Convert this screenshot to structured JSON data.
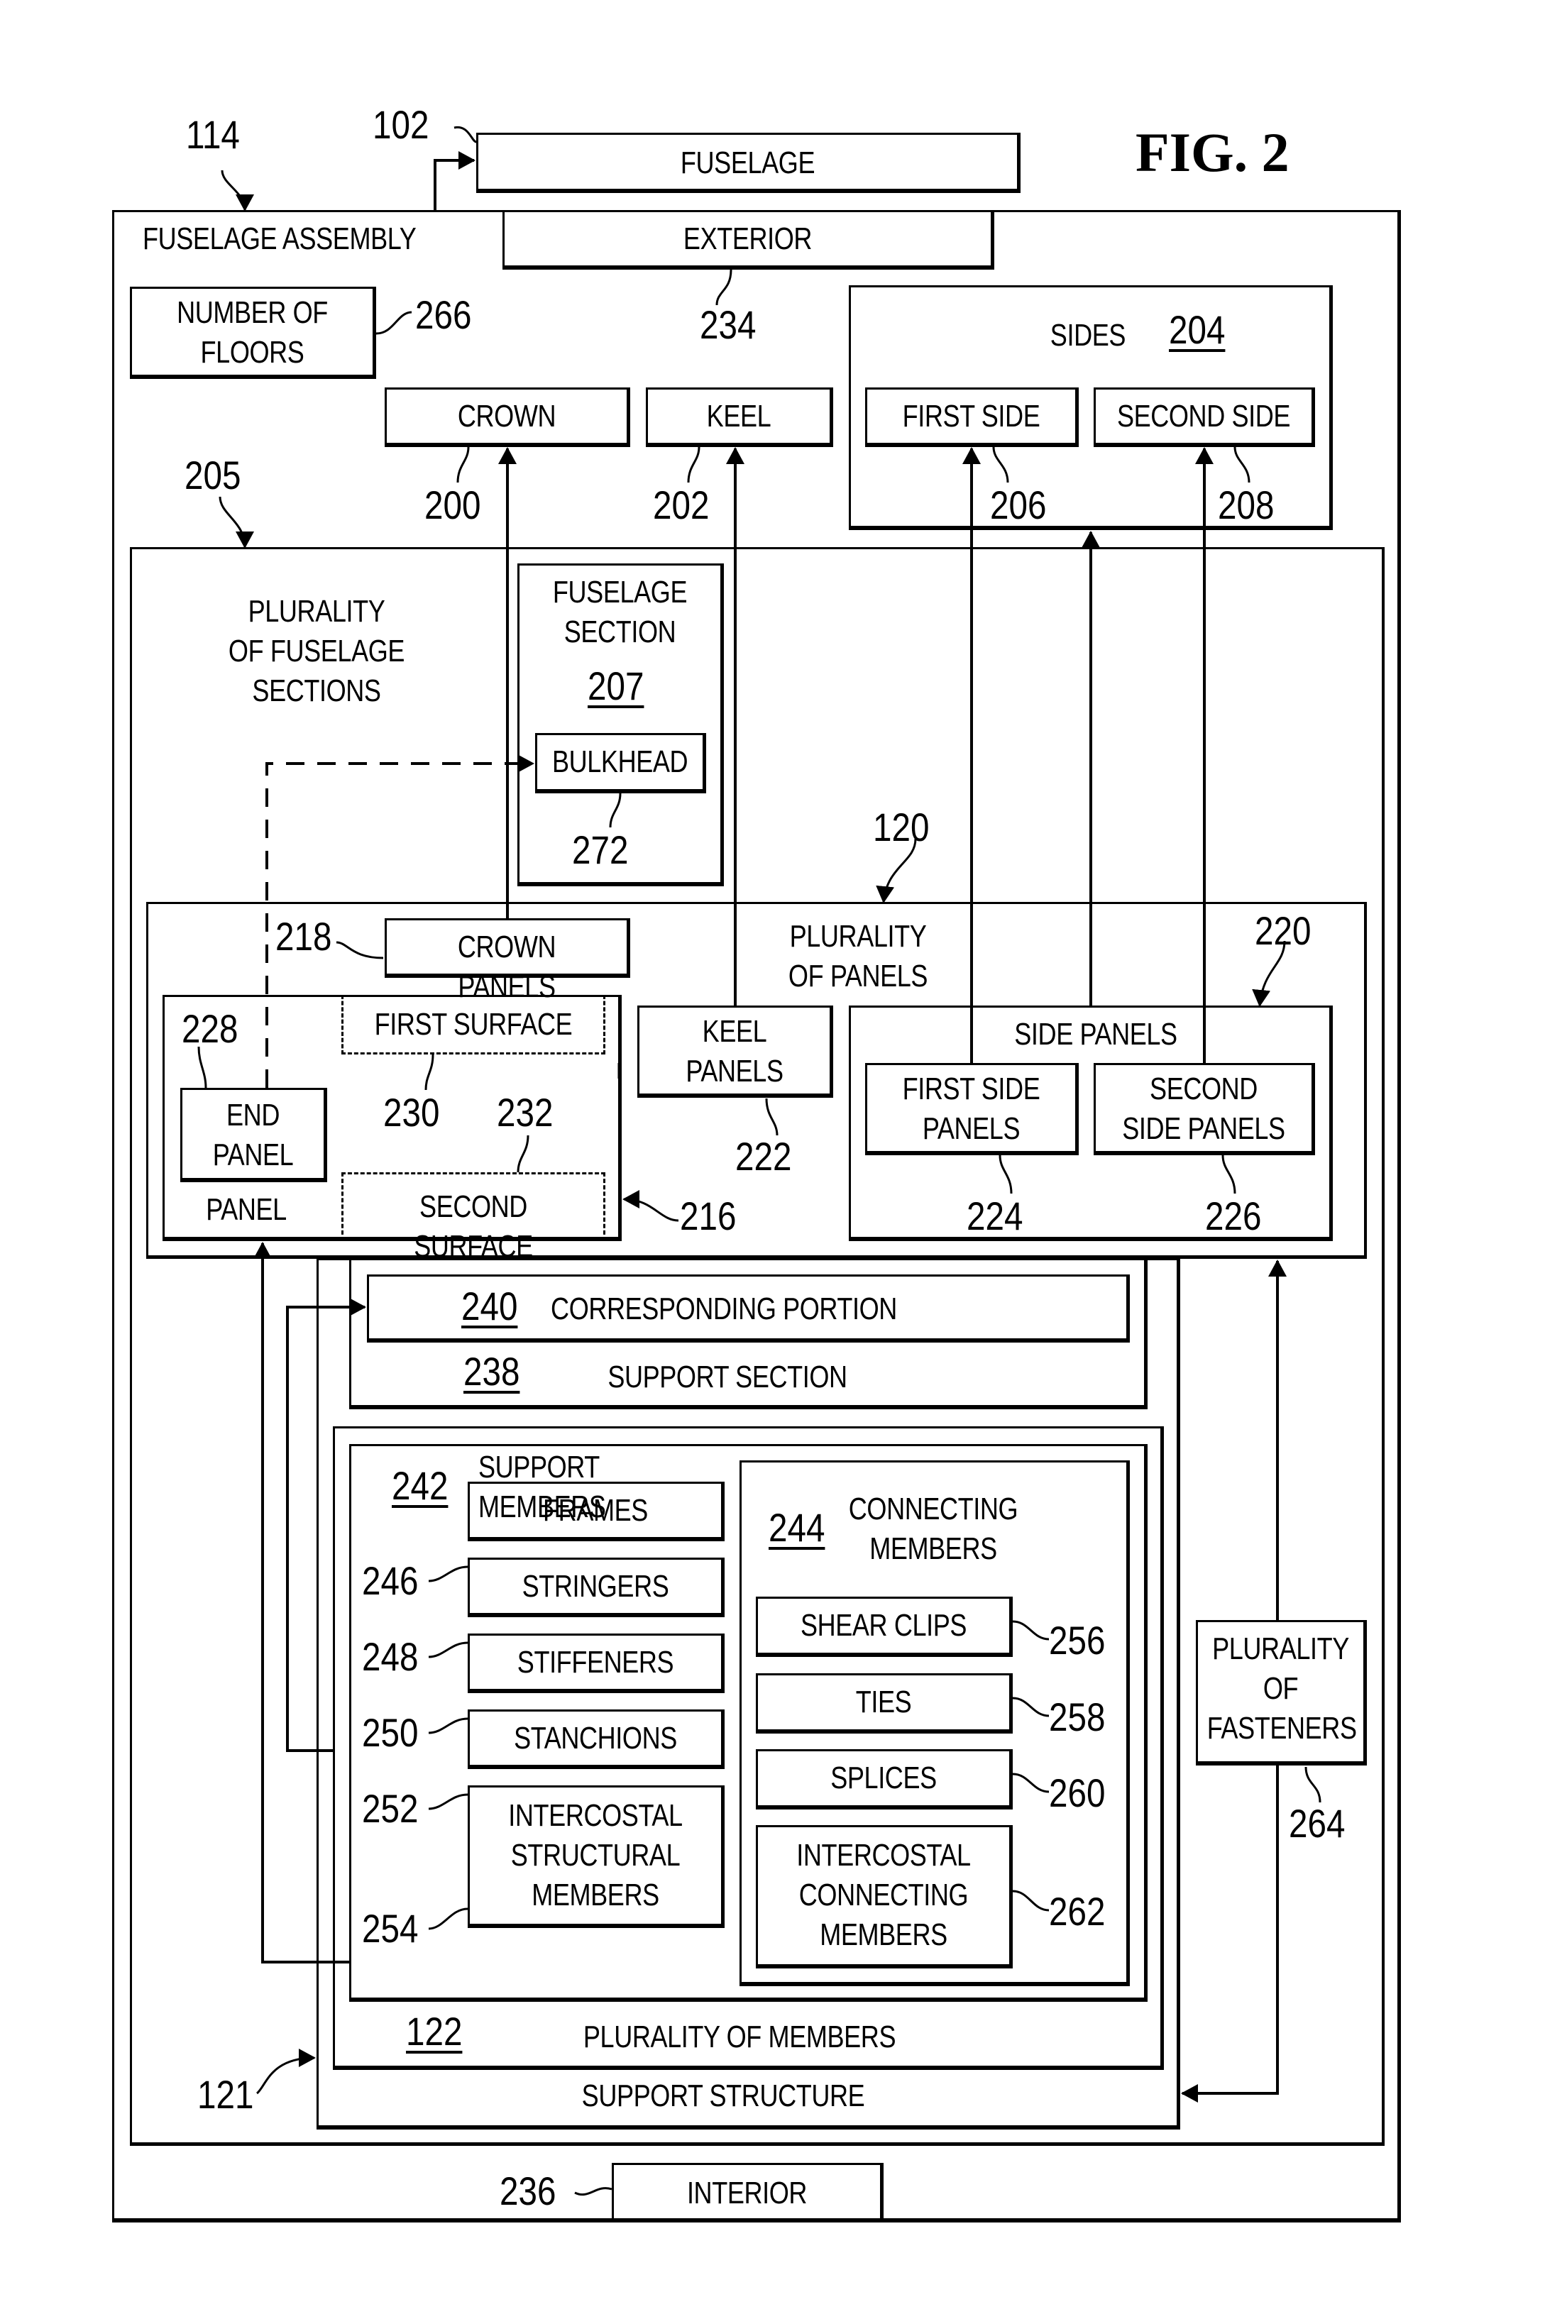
{
  "figure_label": "FIG. 2",
  "nodes": {
    "fuselage": {
      "label": "FUSELAGE",
      "ref": "102"
    },
    "fuselage_assembly": {
      "label": "FUSELAGE ASSEMBLY",
      "ref": "114"
    },
    "exterior": {
      "label": "EXTERIOR",
      "ref": "234"
    },
    "number_of_floors": {
      "label": "NUMBER OF\nFLOORS",
      "ref": "266"
    },
    "crown": {
      "label": "CROWN",
      "ref": "200"
    },
    "keel": {
      "label": "KEEL",
      "ref": "202"
    },
    "sides": {
      "label": "SIDES",
      "ref": "204"
    },
    "first_side": {
      "label": "FIRST SIDE",
      "ref": "206"
    },
    "second_side": {
      "label": "SECOND SIDE",
      "ref": "208"
    },
    "plurality_of_fuselage_sections": {
      "label": "PLURALITY\nOF FUSELAGE\nSECTIONS",
      "ref": "205"
    },
    "fuselage_section": {
      "label": "FUSELAGE\nSECTION",
      "ref": "207"
    },
    "bulkhead": {
      "label": "BULKHEAD",
      "ref": "272"
    },
    "plurality_of_panels": {
      "label": "PLURALITY\nOF PANELS",
      "ref": "120"
    },
    "crown_panels": {
      "label": "CROWN PANELS",
      "ref": "218"
    },
    "panel": {
      "label": "PANEL",
      "ref": "216"
    },
    "end_panel": {
      "label": "END\nPANEL",
      "ref": "228"
    },
    "first_surface": {
      "label": "FIRST SURFACE",
      "ref": "230"
    },
    "second_surface": {
      "label": "SECOND SURFACE",
      "ref": "232"
    },
    "keel_panels": {
      "label": "KEEL\nPANELS",
      "ref": "222"
    },
    "side_panels": {
      "label": "SIDE PANELS",
      "ref": "220"
    },
    "first_side_panels": {
      "label": "FIRST SIDE\nPANELS",
      "ref": "224"
    },
    "second_side_panels": {
      "label": "SECOND\nSIDE PANELS",
      "ref": "226"
    },
    "corresponding_portion": {
      "label": "CORRESPONDING PORTION",
      "ref": "240"
    },
    "support_section": {
      "label": "SUPPORT SECTION",
      "ref": "238"
    },
    "support_members": {
      "label": "SUPPORT\nMEMBERS",
      "ref": "242"
    },
    "frames": {
      "label": "FRAMES",
      "ref": "246"
    },
    "stringers": {
      "label": "STRINGERS",
      "ref": "248"
    },
    "stiffeners": {
      "label": "STIFFENERS",
      "ref": "250"
    },
    "stanchions": {
      "label": "STANCHIONS",
      "ref": "252"
    },
    "intercostal_structural_members": {
      "label": "INTERCOSTAL\nSTRUCTURAL\nMEMBERS",
      "ref": "254"
    },
    "connecting_members": {
      "label": "CONNECTING\nMEMBERS",
      "ref": "244"
    },
    "shear_clips": {
      "label": "SHEAR CLIPS",
      "ref": "256"
    },
    "ties": {
      "label": "TIES",
      "ref": "258"
    },
    "splices": {
      "label": "SPLICES",
      "ref": "260"
    },
    "intercostal_connecting_members": {
      "label": "INTERCOSTAL\nCONNECTING\nMEMBERS",
      "ref": "262"
    },
    "plurality_of_members": {
      "label": "PLURALITY OF MEMBERS",
      "ref": "122"
    },
    "support_structure": {
      "label": "SUPPORT STRUCTURE",
      "ref": "121"
    },
    "plurality_of_fasteners": {
      "label": "PLURALITY\nOF\nFASTENERS",
      "ref": "264"
    },
    "interior": {
      "label": "INTERIOR",
      "ref": "236"
    }
  }
}
